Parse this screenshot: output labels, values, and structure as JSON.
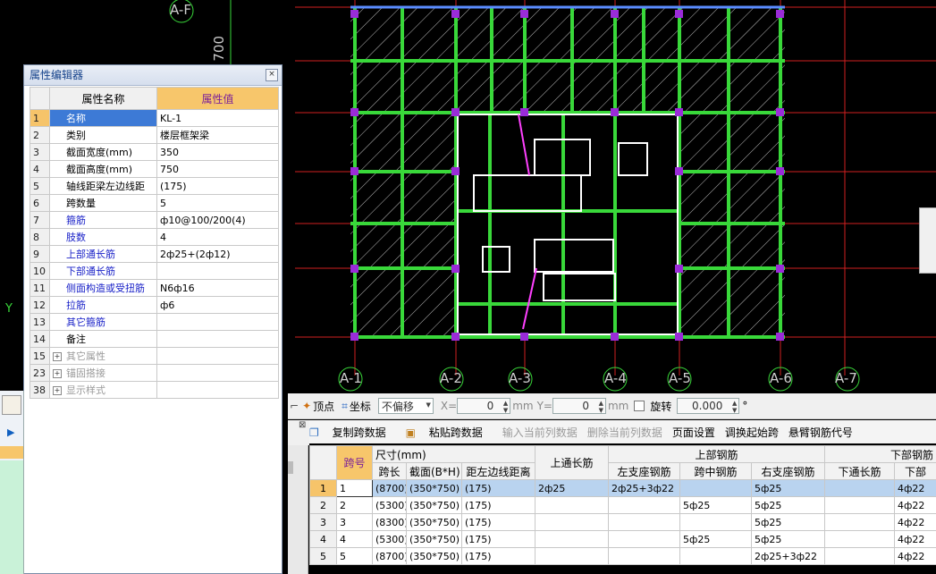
{
  "cad": {
    "axis_labels": [
      "A-F",
      "A-1",
      "A-2",
      "A-3",
      "A-4",
      "A-5",
      "A-6",
      "A-7"
    ],
    "dim_text": "700",
    "partial_label": "Y"
  },
  "property_editor": {
    "title": "属性编辑器",
    "col_name": "属性名称",
    "col_value": "属性值",
    "rows": [
      {
        "idx": "1",
        "name": "名称",
        "value": "KL-1"
      },
      {
        "idx": "2",
        "name": "类别",
        "value": "楼层框架梁"
      },
      {
        "idx": "3",
        "name": "截面宽度(mm)",
        "value": "350"
      },
      {
        "idx": "4",
        "name": "截面高度(mm)",
        "value": "750"
      },
      {
        "idx": "5",
        "name": "轴线距梁左边线距",
        "value": "(175)"
      },
      {
        "idx": "6",
        "name": "跨数量",
        "value": "5"
      },
      {
        "idx": "7",
        "name": "箍筋",
        "value": "ф10@100/200(4)"
      },
      {
        "idx": "8",
        "name": "肢数",
        "value": "4"
      },
      {
        "idx": "9",
        "name": "上部通长筋",
        "value": "2ф25+(2ф12)"
      },
      {
        "idx": "10",
        "name": "下部通长筋",
        "value": ""
      },
      {
        "idx": "11",
        "name": "侧面构造或受扭筋",
        "value": "N6ф16"
      },
      {
        "idx": "12",
        "name": "拉筋",
        "value": "ф6"
      },
      {
        "idx": "13",
        "name": "其它箍筋",
        "value": ""
      },
      {
        "idx": "14",
        "name": "备注",
        "value": ""
      },
      {
        "idx": "15",
        "name": "其它属性",
        "value": ""
      },
      {
        "idx": "23",
        "name": "锚固搭接",
        "value": ""
      },
      {
        "idx": "38",
        "name": "显示样式",
        "value": ""
      }
    ]
  },
  "coord_bar": {
    "vertex": "顶点",
    "coord": "坐标",
    "offset_mode": "不偏移",
    "x_label": "X=",
    "x_value": "0",
    "mm1": "mm",
    "y_label": "Y=",
    "y_value": "0",
    "mm2": "mm",
    "rotate": "旋转",
    "rotate_value": "0.000",
    "deg": "°"
  },
  "span_toolbar": {
    "copy": "复制跨数据",
    "paste": "粘贴跨数据",
    "input_col": "输入当前列数据",
    "delete_col": "删除当前列数据",
    "page_setup": "页面设置",
    "swap_start": "调换起始跨",
    "cantilever": "悬臂钢筋代号"
  },
  "span_table": {
    "h_span": "跨号",
    "h_size": "尺寸(mm)",
    "h_len": "跨长",
    "h_section": "截面(B*H)",
    "h_dist": "距左边线距离",
    "h_top_cont": "上通长筋",
    "h_top_bar": "上部钢筋",
    "h_left_sup": "左支座钢筋",
    "h_mid": "跨中钢筋",
    "h_right_sup": "右支座钢筋",
    "h_bottom_bar": "下部钢筋",
    "h_bot_cont": "下通长筋",
    "h_bot": "下部",
    "rows": [
      {
        "rn": "1",
        "span": "1",
        "len": "(8700)",
        "sec": "(350*750)",
        "dist": "(175)",
        "top": "2ф25",
        "left": "2ф25+3ф22",
        "mid": "",
        "right": "5ф25",
        "botc": "",
        "bot": "4ф22"
      },
      {
        "rn": "2",
        "span": "2",
        "len": "(5300)",
        "sec": "(350*750)",
        "dist": "(175)",
        "top": "",
        "left": "",
        "mid": "5ф25",
        "right": "5ф25",
        "botc": "",
        "bot": "4ф22"
      },
      {
        "rn": "3",
        "span": "3",
        "len": "(8300)",
        "sec": "(350*750)",
        "dist": "(175)",
        "top": "",
        "left": "",
        "mid": "",
        "right": "5ф25",
        "botc": "",
        "bot": "4ф22"
      },
      {
        "rn": "4",
        "span": "4",
        "len": "(5300)",
        "sec": "(350*750)",
        "dist": "(175)",
        "top": "",
        "left": "",
        "mid": "5ф25",
        "right": "5ф25",
        "botc": "",
        "bot": "4ф22"
      },
      {
        "rn": "5",
        "span": "5",
        "len": "(8700)",
        "sec": "(350*750)",
        "dist": "(175)",
        "top": "",
        "left": "",
        "mid": "",
        "right": "2ф25+3ф22",
        "botc": "",
        "bot": "4ф22"
      }
    ]
  }
}
